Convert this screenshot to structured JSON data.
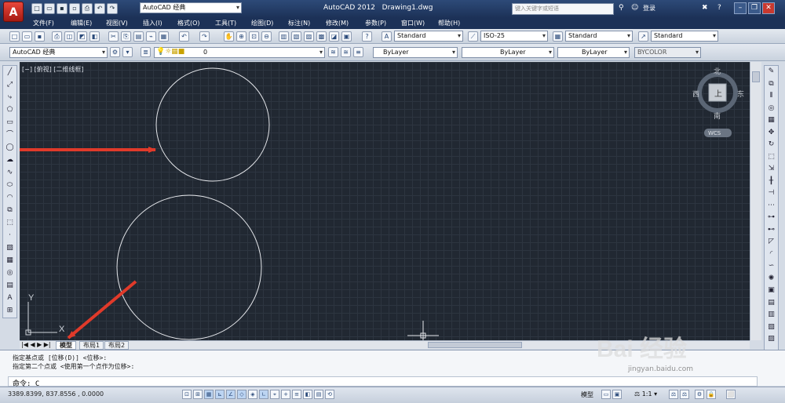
{
  "app": {
    "title": "AutoCAD 2012",
    "document": "Drawing1.dwg",
    "workspace": "AutoCAD 经典",
    "logo": "A"
  },
  "search": {
    "placeholder": "键入关键字或短语"
  },
  "login": "登录",
  "menu": [
    "文件(F)",
    "编辑(E)",
    "视图(V)",
    "插入(I)",
    "格式(O)",
    "工具(T)",
    "绘图(D)",
    "标注(N)",
    "修改(M)",
    "参数(P)",
    "窗口(W)",
    "帮助(H)"
  ],
  "styles": {
    "text": "Standard",
    "dim": "ISO-25",
    "table": "Standard",
    "mleader": "Standard"
  },
  "layers": {
    "workspace": "AutoCAD 经典",
    "current": "0",
    "color": "ByLayer",
    "linetype": "ByLayer",
    "lineweight": "ByLayer",
    "plotstyle": "BYCOLOR"
  },
  "viewport_label": "[−] [俯视] [二维线框]",
  "viewcube": {
    "north": "北",
    "south": "南",
    "east": "东",
    "west": "西",
    "face": "上",
    "ucs": "WCS"
  },
  "ucs_axes": {
    "x": "X",
    "y": "Y"
  },
  "tabs": [
    "模型",
    "布局1",
    "布局2"
  ],
  "command": {
    "line1": "指定基点或 [位移(D)] <位移>:",
    "line2": "指定第二个点或 <使用第一个点作为位移>:",
    "prompt": "命令: C"
  },
  "status": {
    "coords": "3389.8399, 837.8556 , 0.0000",
    "model": "模型",
    "scale": "1:1"
  },
  "colors": {
    "canvas": "#212832",
    "grid": "#2d3540",
    "arrow": "#e03a2a",
    "titlebar": "#1c3157"
  },
  "watermark": {
    "logo": "Bai 经验",
    "url": "jingyan.baidu.com"
  }
}
